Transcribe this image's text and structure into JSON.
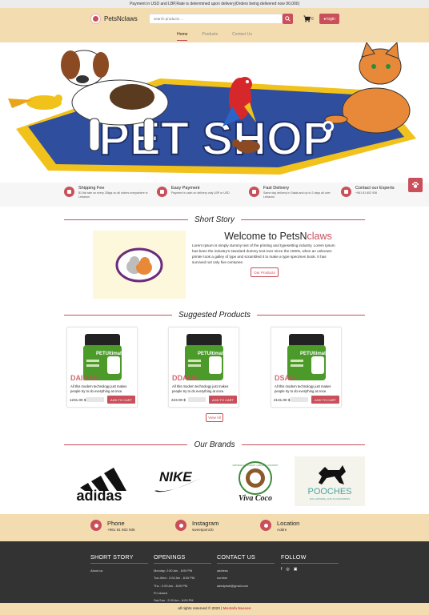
{
  "topbar": {
    "text": "Payment in USD and LBP,Rate is determined upon delivery|Orders being delivered now 90,000|"
  },
  "header": {
    "logo_text": "PetsNclaws",
    "search_placeholder": "search products ...",
    "cart_count": "0",
    "login_label": "login",
    "nav": [
      "Home",
      "Products",
      "Contact Us"
    ]
  },
  "hero": {
    "banner_text": "PET SHOP"
  },
  "features": [
    {
      "title": "Shipping Fee",
      "desc": "$1 flat rate on every 25kgs on all orders everywhere in Lebanon",
      "icon": "truck-icon"
    },
    {
      "title": "Easy Payment",
      "desc": "Payment is cash on delivery only LBP or USD",
      "icon": "credit-card-icon"
    },
    {
      "title": "Fast Delivery",
      "desc": "Same day delivery in Saida and up to 2 days all over Lebanon",
      "icon": "delivery-icon"
    },
    {
      "title": "Contact our Experts",
      "desc": "+961 81 602 936",
      "icon": "chat-icon"
    }
  ],
  "story": {
    "section_title": "Short Story",
    "heading_a": "Welcome to PetsN",
    "heading_b": "claws",
    "body": "Lorem Ipsum is simply dummy text of the printing and typesetting industry. Lorem Ipsum has been the industry's standard dummy text ever since the 1500s, when an unknown printer took a galley of type and scrambled it to make a type specimen book. It has survived not only five centuries.",
    "button": "Our Products"
  },
  "products": {
    "section_title": "Suggested Products",
    "jar_brand": "PETUltimates",
    "items": [
      {
        "name": "DAIDAD",
        "desc": "All this modern technology just makes people try to do everything at once.",
        "price": "1231.00 $",
        "button": "ADD TO CART"
      },
      {
        "name": "DDAOD",
        "desc": "All this modern technology just makes people try to do everything at once.",
        "price": "223.00 $",
        "button": "ADD TO CART"
      },
      {
        "name": "DSAD",
        "desc": "All this modern technology just makes people try to do everything at once.",
        "price": "2131.00 $",
        "button": "ADD TO CART"
      }
    ],
    "view_all": "View All"
  },
  "brands": {
    "section_title": "Our Brands",
    "items": [
      {
        "name": "adidas"
      },
      {
        "name": "NIKE"
      },
      {
        "name": "Viva Coco",
        "ring": "NATURALLY COCONUT • NATURAL COCONUT"
      },
      {
        "name": "POOCHES",
        "sub": "DOG APPAREL AND ACCESSORIES"
      }
    ]
  },
  "contact": [
    {
      "title": "Phone",
      "value": "+961 81 602 936",
      "icon": "phone-icon"
    },
    {
      "title": "Instagram",
      "value": "sweetpoint.lb",
      "icon": "instagram-icon"
    },
    {
      "title": "Location",
      "value": "Addre",
      "icon": "location-pin-icon"
    }
  ],
  "footer": {
    "short_story": {
      "title": "SHORT STORY",
      "lines": [
        "About us"
      ]
    },
    "openings": {
      "title": "OPENINGS",
      "lines": [
        "Monday: 2:00 Am - 8:00 PM",
        "Tue-Wed : 2:00 Am - 8:00 PM",
        "Thu : 2:00 Am - 8:00 PM",
        "Fri closed",
        "Sat-Sun : 2:00 Am - 8:00 PM"
      ]
    },
    "contact_us": {
      "title": "CONTACT US",
      "lines": [
        "address",
        "number",
        "adedpeub@gmail.com"
      ]
    },
    "follow": {
      "title": "FOLLOW",
      "icons": [
        "f",
        "◎",
        "▣"
      ]
    }
  },
  "copyright": {
    "text": "all rights reserved © 2023 |",
    "author": "Mostafa Nassen"
  },
  "colors": {
    "accent": "#c94f5a",
    "header_bg": "#f3dcb0",
    "footer_bg": "#333333"
  }
}
